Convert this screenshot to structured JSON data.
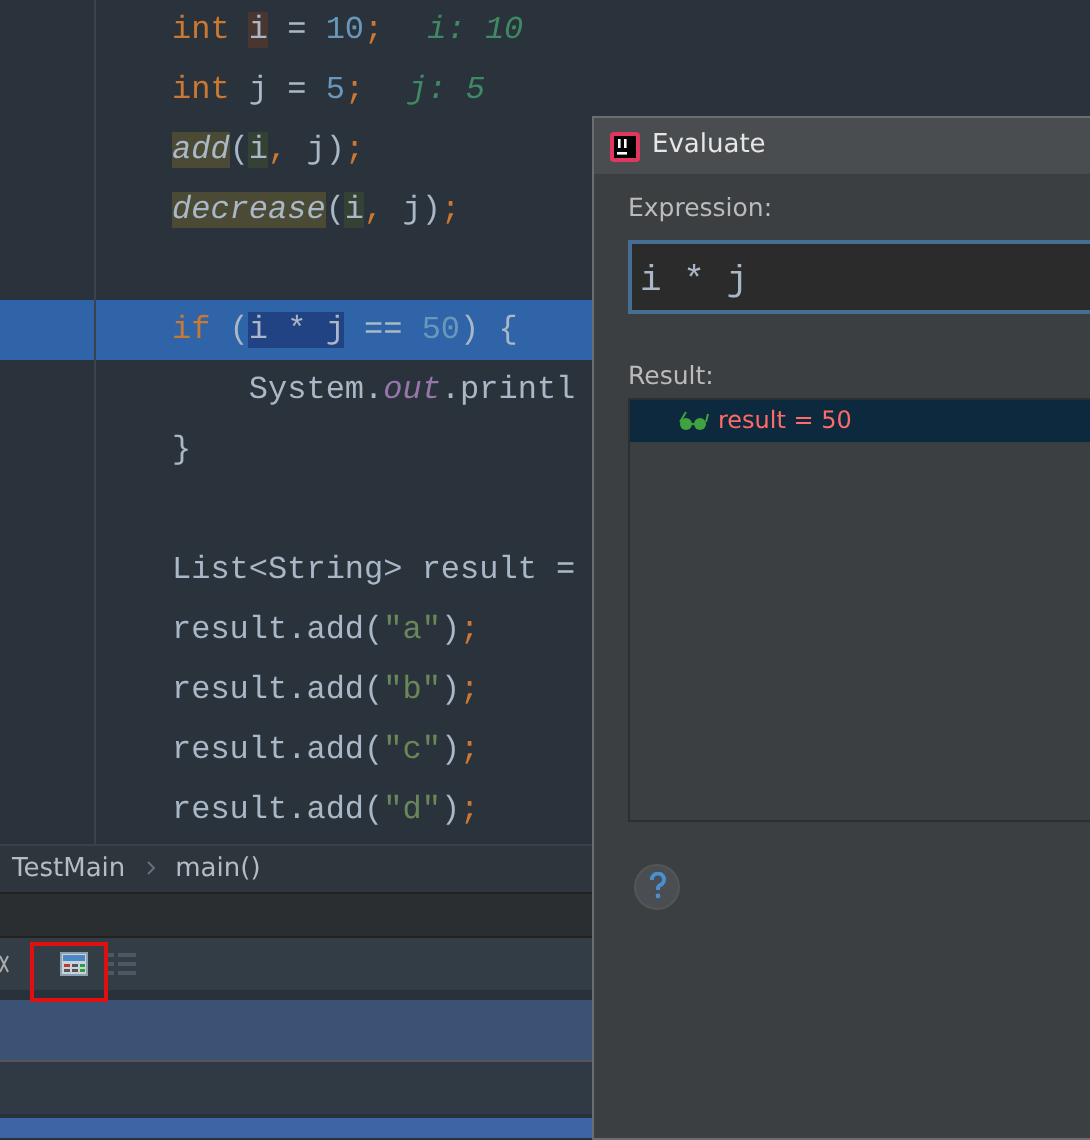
{
  "editor": {
    "lines": [
      {
        "highlighted": false,
        "tokens": [
          {
            "text": "int ",
            "kind": "keyword"
          },
          {
            "text": "i",
            "write_usage": true
          },
          {
            "text": " = "
          },
          {
            "text": "10",
            "kind": "number"
          },
          {
            "text": ";",
            "kind": "keyword"
          }
        ],
        "hint": "i: 10"
      },
      {
        "highlighted": false,
        "tokens": [
          {
            "text": "int",
            "kind": "keyword"
          },
          {
            "text": " j = "
          },
          {
            "text": "5",
            "kind": "number"
          },
          {
            "text": ";",
            "kind": "keyword"
          }
        ],
        "hint": "j: 5"
      },
      {
        "highlighted": false,
        "tokens": [
          {
            "text": "add",
            "kind": "method",
            "call_usage": true
          },
          {
            "text": "("
          },
          {
            "text": "i",
            "read_usage": true
          },
          {
            "text": ", ",
            "kind": "keyword"
          },
          {
            "text": "j)"
          },
          {
            "text": ";",
            "kind": "keyword"
          }
        ]
      },
      {
        "highlighted": false,
        "tokens": [
          {
            "text": "decrease",
            "kind": "method",
            "call_usage": true
          },
          {
            "text": "("
          },
          {
            "text": "i",
            "read_usage": true
          },
          {
            "text": ", ",
            "kind": "keyword"
          },
          {
            "text": "j)"
          },
          {
            "text": ";",
            "kind": "keyword"
          }
        ]
      },
      {
        "highlighted": false
      },
      {
        "highlighted": true,
        "tokens": [
          {
            "text": "if",
            "kind": "keyword"
          },
          {
            "text": " ("
          },
          {
            "text": "i * j",
            "selected": true
          },
          {
            "text": " == "
          },
          {
            "text": "50",
            "kind": "number"
          },
          {
            "text": ") {"
          }
        ]
      },
      {
        "highlighted": false,
        "tokens": [
          {
            "text": "    System."
          },
          {
            "text": "out",
            "kind": "field"
          },
          {
            "text": ".printl"
          }
        ]
      },
      {
        "highlighted": false,
        "tokens": [
          {
            "text": "}"
          }
        ]
      },
      {
        "highlighted": false
      },
      {
        "highlighted": false,
        "tokens": [
          {
            "text": "List<String> result ="
          }
        ]
      },
      {
        "highlighted": false,
        "tokens": [
          {
            "text": "result.add("
          },
          {
            "text": "\"a\"",
            "kind": "string"
          },
          {
            "text": ")"
          },
          {
            "text": ";",
            "kind": "keyword"
          }
        ]
      },
      {
        "highlighted": false,
        "tokens": [
          {
            "text": "result.add("
          },
          {
            "text": "\"b\"",
            "kind": "string"
          },
          {
            "text": ")"
          },
          {
            "text": ";",
            "kind": "keyword"
          }
        ]
      },
      {
        "highlighted": false,
        "tokens": [
          {
            "text": "result.add("
          },
          {
            "text": "\"c\"",
            "kind": "string"
          },
          {
            "text": ")"
          },
          {
            "text": ";",
            "kind": "keyword"
          }
        ]
      },
      {
        "highlighted": false,
        "tokens": [
          {
            "text": "result.add("
          },
          {
            "text": "\"d\"",
            "kind": "string"
          },
          {
            "text": ")"
          },
          {
            "text": ";",
            "kind": "keyword"
          }
        ]
      }
    ]
  },
  "breadcrumbs": [
    "TestMain",
    "main()"
  ],
  "dialog": {
    "title": "Evaluate",
    "expression_label": "Expression:",
    "expression": "i * j",
    "result_label": "Result:",
    "results": [
      {
        "text": "result = 50",
        "selected": true
      }
    ]
  }
}
